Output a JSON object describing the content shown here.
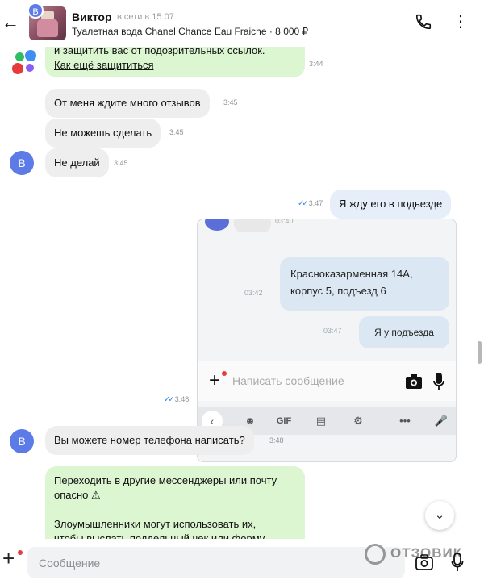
{
  "header": {
    "back_icon": "arrow-left-icon",
    "avatar_letter": "В",
    "name": "Виктор",
    "status": "в сети в 15:07",
    "subtitle": "Туалетная вода Chanel Chance Eau Fraiche · 8 000 ₽",
    "call_icon": "phone-icon",
    "menu_icon": "more-vertical-icon"
  },
  "messages": {
    "system_line": "и защитить вас от подозрительных ссылок.",
    "system_link": "Как ещё защититься",
    "system_time": "3:44",
    "m1_text": "От меня ждите много отзывов",
    "m1_time": "3:45",
    "m2_text": "Не можешь сделать",
    "m2_time": "3:45",
    "m3_avatar": "В",
    "m3_text": "Не делай",
    "m3_time": "3:45",
    "m4_text": "Я жду его в подьезде",
    "m4_time": "3:47",
    "m4_ticks": "✓✓",
    "m5_time": "3:48",
    "m5_ticks": "✓✓",
    "m6_avatar": "В",
    "m6_text": "Вы можете номер телефона написать?",
    "m6_time": "3:48",
    "m7_line1": "Переходить в другие мессенджеры или почту",
    "m7_line2": "опасно ⚠",
    "m7_line3": "Злоумышленники могут использовать их,",
    "m7_line4": "чтобы выслать поддельный чек или форму"
  },
  "attachment": {
    "bubble1_line1": "Красноказарменная 14А,",
    "bubble1_line2": "корпус 5, подъезд 6",
    "bubble1_time": "03:42",
    "bubble2_text": "Я у подъезда",
    "bubble2_time": "03:47",
    "input_placeholder": "Написать сообщение",
    "kb_gif": "GIF",
    "kb_more": "•••"
  },
  "composer": {
    "placeholder": "Сообщение",
    "watermark": "ОТЗОВИК"
  },
  "colors": {
    "incoming": "#eeeeee",
    "outgoing": "#e5eef9",
    "system": "#dcf6d2",
    "avatar": "#5d7be6",
    "ticks": "#3b8bde"
  }
}
